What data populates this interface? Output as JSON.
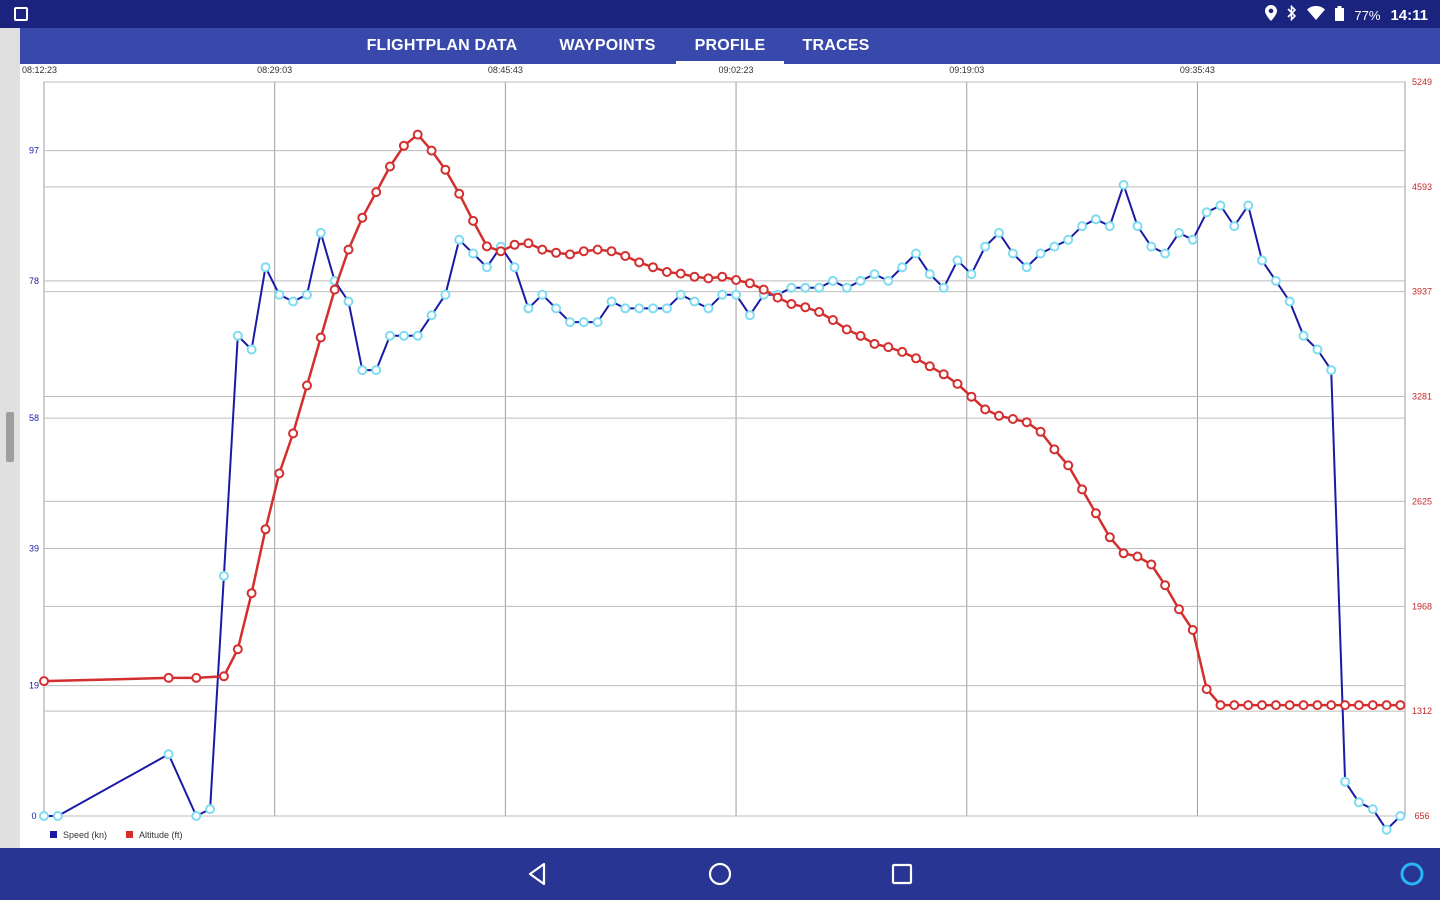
{
  "status_bar": {
    "battery": "77%",
    "time": "14:11",
    "icons": [
      "location-icon",
      "bluetooth-icon",
      "wifi-icon",
      "battery-icon"
    ]
  },
  "tabs": [
    {
      "label": "FLIGHTPLAN DATA",
      "active": false
    },
    {
      "label": "WAYPOINTS",
      "active": false
    },
    {
      "label": "PROFILE",
      "active": true
    },
    {
      "label": "TRACES",
      "active": false
    }
  ],
  "nav": [
    "back-icon",
    "home-icon",
    "recents-icon",
    "assistant-icon"
  ],
  "chart_data": {
    "type": "line",
    "x_ticks": [
      "08:12:23",
      "08:29:03",
      "08:45:43",
      "09:02:23",
      "09:19:03",
      "09:35:43"
    ],
    "x_range": [
      "08:12:23",
      "09:50:43"
    ],
    "y_left": {
      "ticks": [
        "0",
        "19",
        "39",
        "58",
        "78",
        "97"
      ],
      "range": [
        0,
        107
      ]
    },
    "y_right": {
      "ticks": [
        "656",
        "1312",
        "1968",
        "2625",
        "3281",
        "3937",
        "4593",
        "5249"
      ],
      "range": [
        656,
        5249
      ]
    },
    "grid": true,
    "legend": {
      "placement": "bottom-left",
      "entries": [
        {
          "label": "Speed (kn)",
          "color": "#1a1aa6"
        },
        {
          "label": "Altitude (ft)",
          "color": "#d32f2f"
        }
      ]
    },
    "series": [
      {
        "name": "Speed (kn)",
        "axis": "left",
        "color": "#1a1aa6",
        "marker_color": "#7fdcf0",
        "x_minutes": [
          0,
          1,
          9,
          11,
          12,
          13,
          14,
          15,
          16,
          17,
          18,
          19,
          20,
          21,
          22,
          23,
          24,
          25,
          26,
          27,
          28,
          29,
          30,
          31,
          32,
          33,
          34,
          35,
          36,
          37,
          38,
          39,
          40,
          41,
          42,
          43,
          44,
          45,
          46,
          47,
          48,
          49,
          50,
          51,
          52,
          53,
          54,
          55,
          56,
          57,
          58,
          59,
          60,
          61,
          62,
          63,
          64,
          65,
          66,
          67,
          68,
          69,
          70,
          71,
          72,
          73,
          74,
          75,
          76,
          77,
          78,
          79,
          80,
          81,
          82,
          83,
          84,
          85,
          86,
          87,
          88,
          89,
          90,
          91,
          92,
          93,
          94,
          95,
          96,
          97,
          98
        ],
        "values": [
          0,
          0,
          9,
          0,
          1,
          35,
          70,
          68,
          80,
          76,
          75,
          76,
          85,
          78,
          75,
          65,
          65,
          70,
          70,
          70,
          73,
          76,
          84,
          82,
          80,
          83,
          80,
          74,
          76,
          74,
          72,
          72,
          72,
          75,
          74,
          74,
          74,
          74,
          76,
          75,
          74,
          76,
          76,
          73,
          76,
          76,
          77,
          77,
          77,
          78,
          77,
          78,
          79,
          78,
          80,
          82,
          79,
          77,
          81,
          79,
          83,
          85,
          82,
          80,
          82,
          83,
          84,
          86,
          87,
          86,
          92,
          86,
          83,
          82,
          85,
          84,
          88,
          89,
          86,
          89,
          81,
          78,
          75,
          70,
          68,
          65,
          5,
          2,
          1,
          -2,
          0
        ]
      },
      {
        "name": "Altitude (ft)",
        "axis": "right",
        "color": "#d32f2f",
        "marker_color": "#d32f2f",
        "x_minutes": [
          0,
          9,
          11,
          13,
          14,
          15,
          16,
          17,
          18,
          19,
          20,
          21,
          22,
          23,
          24,
          25,
          26,
          27,
          28,
          29,
          30,
          31,
          32,
          33,
          34,
          35,
          36,
          37,
          38,
          39,
          40,
          41,
          42,
          43,
          44,
          45,
          46,
          47,
          48,
          49,
          50,
          51,
          52,
          53,
          54,
          55,
          56,
          57,
          58,
          59,
          60,
          61,
          62,
          63,
          64,
          65,
          66,
          67,
          68,
          69,
          70,
          71,
          72,
          73,
          74,
          75,
          76,
          77,
          78,
          79,
          80,
          81,
          82,
          83,
          84,
          85,
          86,
          87,
          88,
          89,
          90,
          91,
          92,
          93,
          94,
          95,
          96,
          97,
          98
        ],
        "values": [
          1500,
          1520,
          1520,
          1530,
          1700,
          2050,
          2450,
          2800,
          3050,
          3350,
          3650,
          3950,
          4200,
          4400,
          4560,
          4720,
          4850,
          4920,
          4820,
          4700,
          4550,
          4380,
          4220,
          4190,
          4230,
          4240,
          4200,
          4180,
          4170,
          4190,
          4200,
          4190,
          4160,
          4120,
          4090,
          4060,
          4050,
          4030,
          4020,
          4030,
          4010,
          3990,
          3950,
          3900,
          3860,
          3840,
          3810,
          3760,
          3700,
          3660,
          3610,
          3590,
          3560,
          3520,
          3470,
          3420,
          3360,
          3280,
          3200,
          3160,
          3140,
          3120,
          3060,
          2950,
          2850,
          2700,
          2550,
          2400,
          2300,
          2280,
          2230,
          2100,
          1950,
          1820,
          1450,
          1350,
          1350,
          1350,
          1350,
          1350,
          1350,
          1350,
          1350,
          1350,
          1350,
          1350,
          1350,
          1350,
          1350
        ]
      }
    ]
  }
}
